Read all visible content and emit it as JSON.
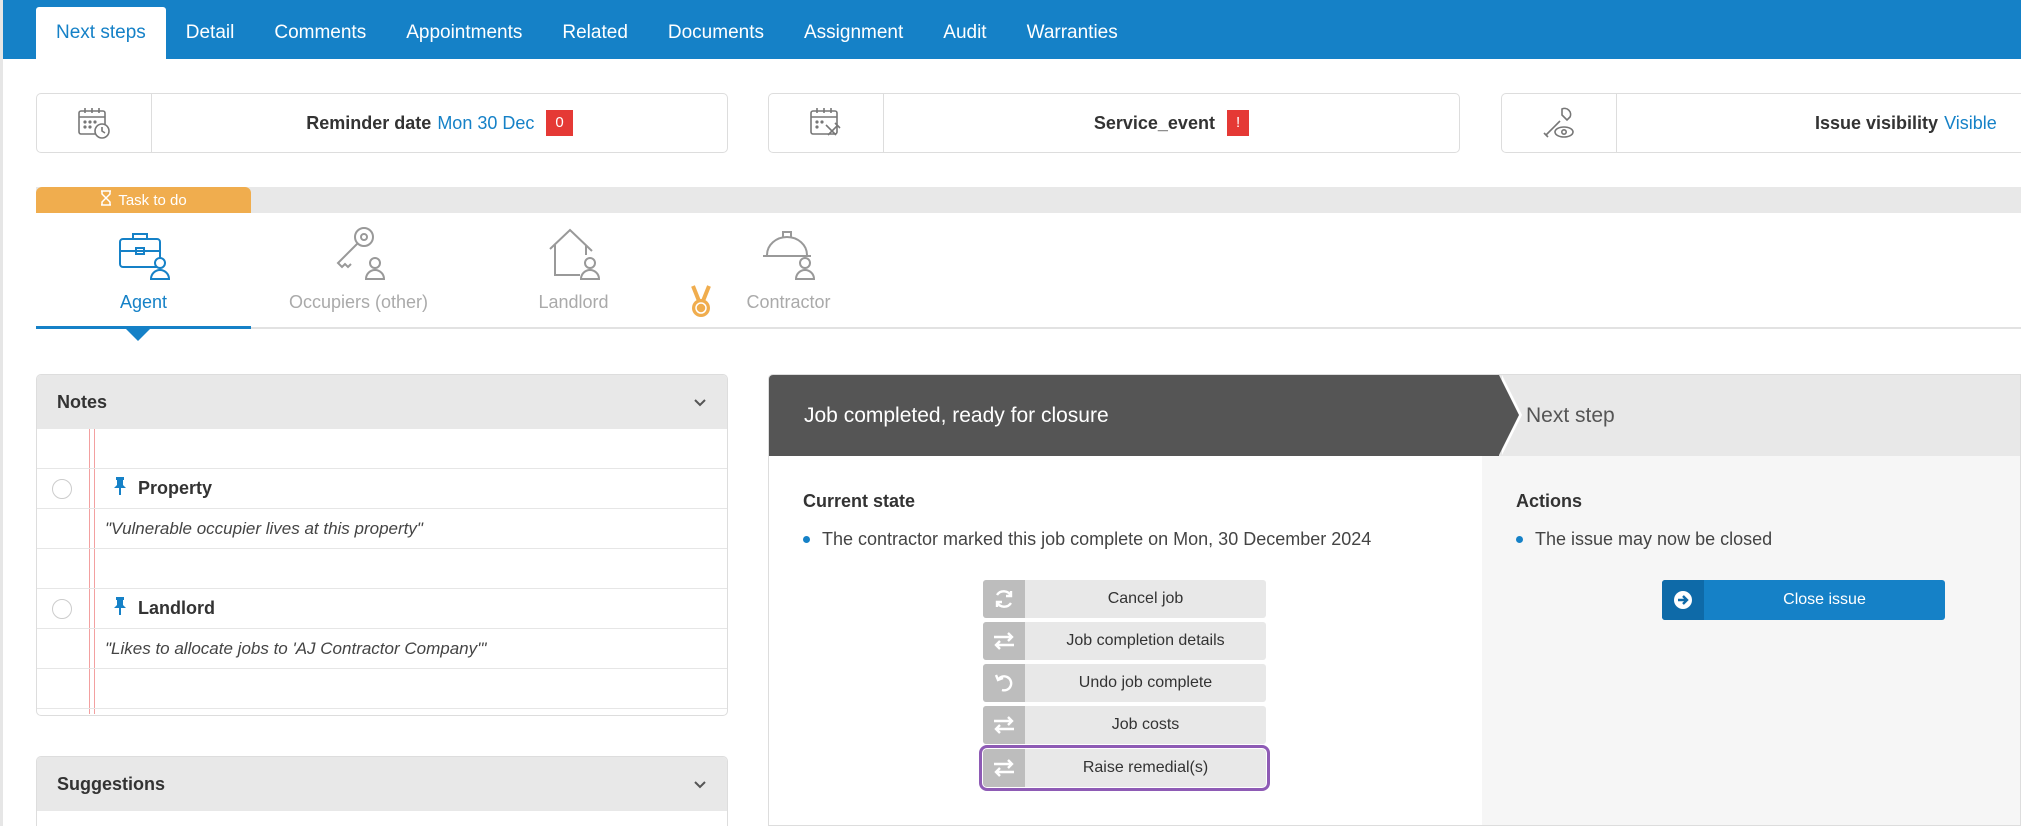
{
  "tabs": [
    "Next steps",
    "Detail",
    "Comments",
    "Appointments",
    "Related",
    "Documents",
    "Assignment",
    "Audit",
    "Warranties"
  ],
  "info_cards": {
    "reminder": {
      "label": "Reminder date",
      "value": "Mon 30 Dec",
      "badge": "0"
    },
    "service": {
      "label": "Service_event",
      "badge": "!"
    },
    "visibility": {
      "label": "Issue visibility",
      "value": "Visible"
    }
  },
  "task": {
    "label": "Task to do"
  },
  "roles": [
    "Agent",
    "Occupiers (other)",
    "Landlord",
    "Contractor"
  ],
  "notes": {
    "title": "Notes",
    "items": [
      {
        "title": "Property",
        "text": "\"Vulnerable occupier lives at this property\""
      },
      {
        "title": "Landlord",
        "text": "\"Likes to allocate jobs to 'AJ Contractor Company'\""
      }
    ]
  },
  "suggestions": {
    "title": "Suggestions"
  },
  "job": {
    "status_title": "Job completed, ready for closure",
    "next_title": "Next step",
    "current_state_title": "Current state",
    "current_state_text": "The contractor marked this job complete on Mon, 30 December 2024",
    "actions_title": "Actions",
    "actions_text": "The issue may now be closed",
    "buttons": [
      "Cancel job",
      "Job completion details",
      "Undo job complete",
      "Job costs",
      "Raise remedial(s)"
    ],
    "close_button": "Close issue"
  },
  "colors": {
    "primary": "#1581c7",
    "task": "#f0ad4e",
    "badge": "#e53935",
    "dark_header": "#555555",
    "highlight": "#8e5bb5"
  }
}
